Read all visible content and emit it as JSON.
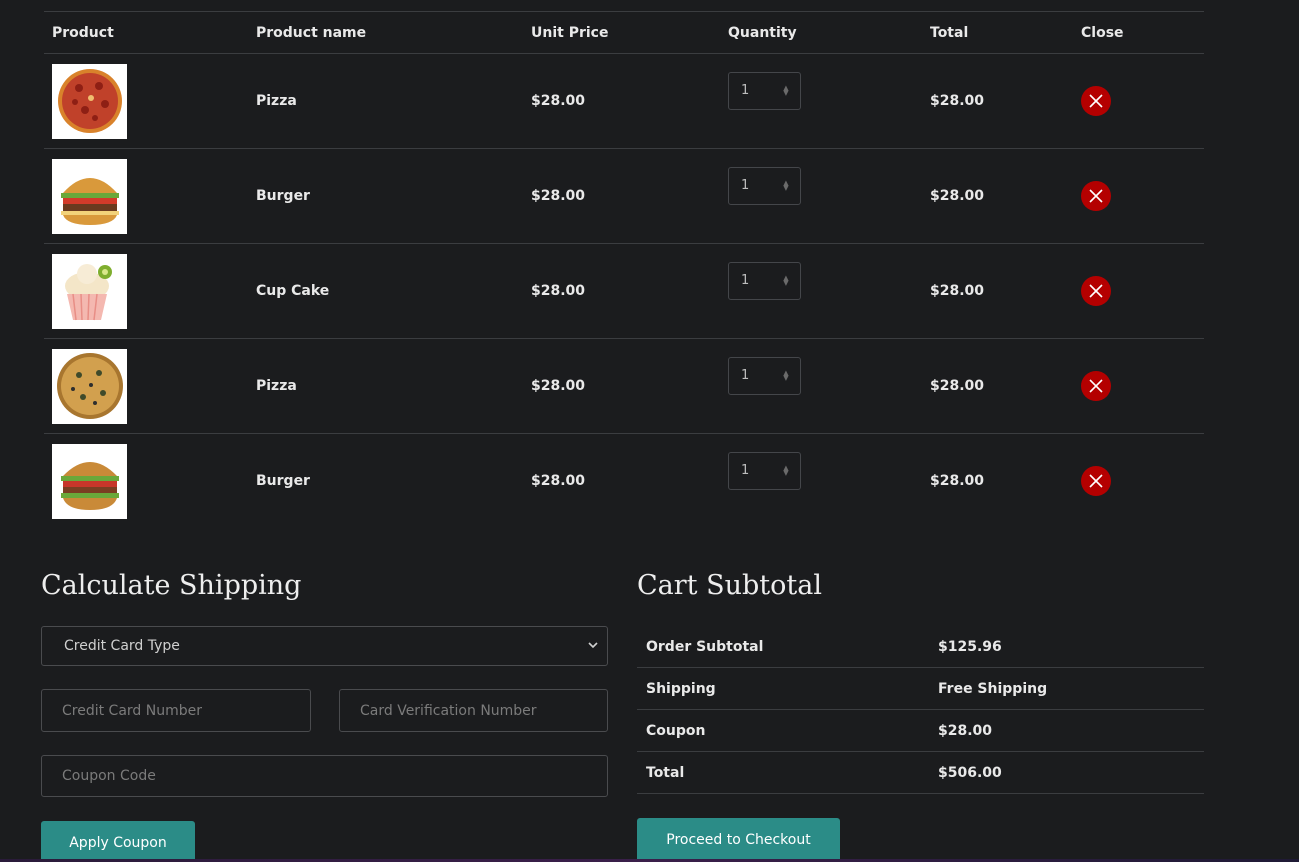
{
  "table": {
    "headers": {
      "product": "Product",
      "name": "Product name",
      "price": "Unit Price",
      "quantity": "Quantity",
      "total": "Total",
      "close": "Close"
    },
    "rows": [
      {
        "name": "Pizza",
        "price": "$28.00",
        "qty": "1",
        "total": "$28.00",
        "image": "pizza-image"
      },
      {
        "name": "Burger",
        "price": "$28.00",
        "qty": "1",
        "total": "$28.00",
        "image": "burger-image"
      },
      {
        "name": "Cup Cake",
        "price": "$28.00",
        "qty": "1",
        "total": "$28.00",
        "image": "cupcake-image"
      },
      {
        "name": "Pizza",
        "price": "$28.00",
        "qty": "1",
        "total": "$28.00",
        "image": "veggie-pizza-image"
      },
      {
        "name": "Burger",
        "price": "$28.00",
        "qty": "1",
        "total": "$28.00",
        "image": "burger-image"
      }
    ]
  },
  "shipping": {
    "title": "Calculate Shipping",
    "card_type": "Credit Card Type",
    "card_number_placeholder": "Credit Card Number",
    "cvv_placeholder": "Card Verification Number",
    "coupon_placeholder": "Coupon Code",
    "apply_label": "Apply Coupon"
  },
  "subtotal": {
    "title": "Cart Subtotal",
    "rows": [
      {
        "label": "Order Subtotal",
        "value": "$125.96"
      },
      {
        "label": "Shipping",
        "value": "Free Shipping"
      },
      {
        "label": "Coupon",
        "value": "$28.00"
      },
      {
        "label": "Total",
        "value": "$506.00"
      }
    ],
    "checkout_label": "Proceed to Checkout"
  },
  "colors": {
    "background": "#1b1c1e",
    "accent": "#2b8c87",
    "remove": "#b40000"
  }
}
